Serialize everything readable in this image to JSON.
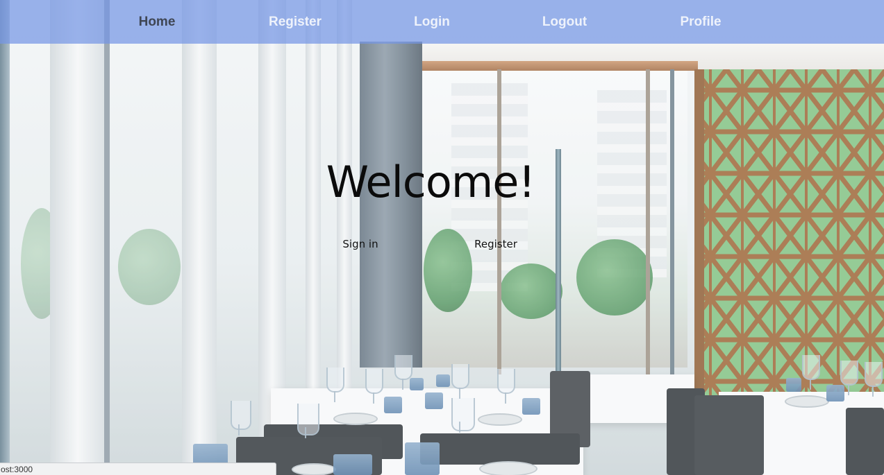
{
  "nav": {
    "items": [
      {
        "label": "Home",
        "active": true
      },
      {
        "label": "Register",
        "active": false
      },
      {
        "label": "Login",
        "active": false
      },
      {
        "label": "Logout",
        "active": false
      },
      {
        "label": "Profile",
        "active": false
      }
    ]
  },
  "hero": {
    "title": "Welcome!",
    "signin_label": "Sign in",
    "register_label": "Register"
  },
  "status_bar": {
    "text": "ost:3000"
  },
  "colors": {
    "navbar_bg": "#7496e4",
    "nav_text": "#eef2fb",
    "nav_active_text": "#3f4654",
    "hero_text": "#0b0b0b"
  },
  "background": {
    "icon": "restaurant-interior-photo"
  }
}
